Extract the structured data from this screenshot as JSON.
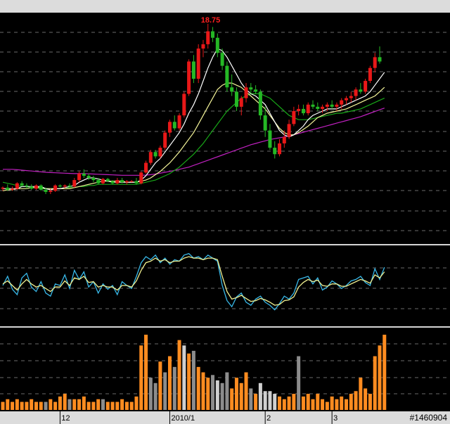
{
  "chart_data": {
    "type": "candlestick",
    "high_label": "18.75",
    "x_labels": [
      {
        "index": 12,
        "text": "12"
      },
      {
        "index": 35,
        "text": "2010/1"
      },
      {
        "index": 55,
        "text": "2"
      },
      {
        "index": 69,
        "text": "3"
      }
    ],
    "watermark": "#1460904",
    "candles": [
      [
        11.1,
        11.2,
        11.0,
        11.15
      ],
      [
        11.15,
        11.3,
        11.0,
        11.05
      ],
      [
        11.05,
        11.2,
        11.0,
        11.1
      ],
      [
        11.1,
        11.4,
        11.05,
        11.35
      ],
      [
        11.35,
        11.45,
        11.2,
        11.25
      ],
      [
        11.25,
        11.35,
        11.1,
        11.2
      ],
      [
        11.2,
        11.3,
        11.05,
        11.1
      ],
      [
        11.1,
        11.3,
        11.05,
        11.25
      ],
      [
        11.25,
        11.3,
        11.0,
        11.05
      ],
      [
        11.05,
        11.15,
        10.85,
        10.95
      ],
      [
        10.95,
        11.1,
        10.85,
        11.0
      ],
      [
        11.0,
        11.3,
        10.95,
        11.25
      ],
      [
        11.25,
        11.3,
        11.15,
        11.2
      ],
      [
        11.2,
        11.3,
        11.1,
        11.25
      ],
      [
        11.25,
        11.35,
        11.15,
        11.2
      ],
      [
        11.2,
        11.6,
        11.15,
        11.5
      ],
      [
        11.5,
        11.9,
        11.4,
        11.8
      ],
      [
        11.8,
        12.0,
        11.6,
        11.7
      ],
      [
        11.7,
        11.8,
        11.5,
        11.6
      ],
      [
        11.6,
        11.7,
        11.4,
        11.5
      ],
      [
        11.5,
        11.6,
        11.3,
        11.35
      ],
      [
        11.35,
        11.6,
        11.3,
        11.55
      ],
      [
        11.55,
        11.6,
        11.4,
        11.45
      ],
      [
        11.45,
        11.5,
        11.3,
        11.35
      ],
      [
        11.35,
        11.6,
        11.3,
        11.5
      ],
      [
        11.5,
        11.6,
        11.35,
        11.4
      ],
      [
        11.4,
        11.5,
        11.3,
        11.45
      ],
      [
        11.45,
        11.5,
        11.4,
        11.45
      ],
      [
        11.45,
        11.6,
        11.3,
        11.35
      ],
      [
        11.35,
        11.9,
        11.3,
        11.85
      ],
      [
        11.85,
        12.4,
        11.8,
        12.3
      ],
      [
        12.3,
        12.9,
        12.2,
        12.8
      ],
      [
        12.8,
        12.9,
        12.5,
        12.6
      ],
      [
        12.6,
        13.1,
        12.5,
        13.0
      ],
      [
        13.0,
        13.8,
        12.9,
        13.7
      ],
      [
        13.7,
        14.3,
        13.5,
        14.2
      ],
      [
        14.2,
        14.5,
        13.8,
        13.9
      ],
      [
        13.9,
        14.6,
        13.8,
        14.5
      ],
      [
        14.5,
        15.6,
        14.4,
        15.5
      ],
      [
        15.5,
        17.1,
        15.4,
        17.0
      ],
      [
        17.0,
        17.3,
        16.0,
        16.2
      ],
      [
        16.2,
        17.8,
        16.0,
        17.6
      ],
      [
        17.6,
        18.0,
        17.2,
        17.8
      ],
      [
        17.8,
        18.75,
        17.6,
        18.4
      ],
      [
        18.4,
        18.6,
        17.9,
        18.1
      ],
      [
        18.1,
        18.3,
        17.2,
        17.4
      ],
      [
        17.4,
        17.6,
        16.6,
        16.8
      ],
      [
        16.8,
        17.0,
        15.6,
        15.8
      ],
      [
        15.8,
        16.4,
        15.4,
        15.6
      ],
      [
        15.6,
        15.8,
        14.7,
        14.9
      ],
      [
        14.9,
        15.4,
        14.5,
        15.3
      ],
      [
        15.3,
        16.0,
        15.1,
        15.8
      ],
      [
        15.8,
        16.0,
        15.5,
        15.7
      ],
      [
        15.7,
        15.9,
        15.5,
        15.6
      ],
      [
        15.6,
        15.7,
        14.3,
        14.5
      ],
      [
        14.5,
        14.9,
        13.5,
        13.8
      ],
      [
        13.8,
        14.1,
        12.9,
        13.0
      ],
      [
        13.0,
        13.3,
        12.5,
        12.7
      ],
      [
        12.7,
        13.4,
        12.6,
        13.2
      ],
      [
        13.2,
        13.8,
        13.0,
        13.5
      ],
      [
        13.5,
        14.3,
        13.4,
        14.1
      ],
      [
        14.1,
        14.9,
        14.0,
        14.7
      ],
      [
        14.7,
        15.0,
        14.5,
        14.8
      ],
      [
        14.8,
        15.0,
        14.5,
        14.6
      ],
      [
        14.6,
        15.1,
        14.5,
        15.0
      ],
      [
        15.0,
        15.2,
        14.8,
        14.9
      ],
      [
        14.9,
        15.1,
        14.7,
        14.8
      ],
      [
        14.8,
        15.0,
        14.6,
        14.9
      ],
      [
        14.9,
        15.1,
        14.7,
        15.0
      ],
      [
        15.0,
        15.2,
        14.8,
        14.9
      ],
      [
        14.9,
        15.1,
        14.7,
        15.0
      ],
      [
        15.0,
        15.3,
        14.8,
        15.2
      ],
      [
        15.2,
        15.4,
        15.0,
        15.3
      ],
      [
        15.3,
        15.6,
        15.1,
        15.4
      ],
      [
        15.4,
        15.8,
        15.2,
        15.7
      ],
      [
        15.7,
        16.0,
        15.5,
        15.6
      ],
      [
        15.6,
        16.2,
        15.5,
        16.1
      ],
      [
        16.1,
        16.8,
        16.0,
        16.7
      ],
      [
        16.7,
        17.4,
        16.5,
        17.2
      ],
      [
        17.2,
        17.7,
        16.9,
        17.0
      ]
    ],
    "ma_fast": [
      11.1,
      11.1,
      11.1,
      11.1,
      11.2,
      11.2,
      11.2,
      11.2,
      11.2,
      11.1,
      11.05,
      11.1,
      11.1,
      11.15,
      11.2,
      11.25,
      11.4,
      11.5,
      11.6,
      11.6,
      11.55,
      11.5,
      11.45,
      11.4,
      11.4,
      11.4,
      11.4,
      11.4,
      11.4,
      11.5,
      11.7,
      12.0,
      12.3,
      12.5,
      12.8,
      13.1,
      13.4,
      13.7,
      14.1,
      14.6,
      15.0,
      15.5,
      16.1,
      16.7,
      17.2,
      17.6,
      17.5,
      17.2,
      16.8,
      16.4,
      16.0,
      15.7,
      15.5,
      15.4,
      15.2,
      15.0,
      14.6,
      14.2,
      13.8,
      13.6,
      13.5,
      13.6,
      13.8,
      14.0,
      14.3,
      14.5,
      14.6,
      14.7,
      14.8,
      14.8,
      14.8,
      14.9,
      15.0,
      15.1,
      15.2,
      15.3,
      15.4,
      15.6,
      15.9,
      16.2,
      16.5
    ],
    "ma_mid": [
      11.0,
      11.05,
      11.05,
      11.1,
      11.1,
      11.1,
      11.15,
      11.15,
      11.15,
      11.1,
      11.1,
      11.1,
      11.1,
      11.1,
      11.1,
      11.15,
      11.2,
      11.25,
      11.3,
      11.35,
      11.4,
      11.45,
      11.45,
      11.45,
      11.45,
      11.45,
      11.4,
      11.4,
      11.4,
      11.45,
      11.5,
      11.6,
      11.75,
      11.9,
      12.1,
      12.3,
      12.55,
      12.8,
      13.1,
      13.4,
      13.7,
      14.1,
      14.5,
      14.9,
      15.3,
      15.7,
      15.9,
      16.0,
      16.0,
      15.9,
      15.8,
      15.6,
      15.4,
      15.2,
      15.0,
      14.8,
      14.5,
      14.2,
      13.9,
      13.7,
      13.6,
      13.6,
      13.7,
      13.85,
      14.0,
      14.2,
      14.4,
      14.5,
      14.6,
      14.65,
      14.7,
      14.75,
      14.8,
      14.9,
      15.0,
      15.1,
      15.2,
      15.3,
      15.4,
      15.6,
      15.8
    ],
    "ma_slow": [
      11.4,
      11.35,
      11.3,
      11.25,
      11.2,
      11.2,
      11.15,
      11.15,
      11.1,
      11.1,
      11.1,
      11.1,
      11.1,
      11.1,
      11.15,
      11.15,
      11.2,
      11.2,
      11.25,
      11.25,
      11.3,
      11.3,
      11.3,
      11.3,
      11.3,
      11.3,
      11.3,
      11.3,
      11.3,
      11.35,
      11.4,
      11.45,
      11.5,
      11.6,
      11.7,
      11.8,
      11.95,
      12.1,
      12.3,
      12.5,
      12.7,
      12.95,
      13.2,
      13.5,
      13.8,
      14.1,
      14.4,
      14.7,
      14.9,
      15.1,
      15.3,
      15.4,
      15.5,
      15.5,
      15.5,
      15.4,
      15.3,
      15.1,
      14.9,
      14.7,
      14.5,
      14.4,
      14.3,
      14.3,
      14.3,
      14.35,
      14.4,
      14.45,
      14.5,
      14.55,
      14.6,
      14.6,
      14.65,
      14.7,
      14.75,
      14.8,
      14.9,
      15.0,
      15.1,
      15.2,
      15.3
    ],
    "ma_long": [
      12.0,
      12.0,
      12.0,
      11.98,
      11.96,
      11.94,
      11.92,
      11.9,
      11.88,
      11.86,
      11.85,
      11.84,
      11.83,
      11.82,
      11.81,
      11.8,
      11.8,
      11.8,
      11.79,
      11.78,
      11.77,
      11.76,
      11.75,
      11.74,
      11.73,
      11.72,
      11.72,
      11.72,
      11.72,
      11.72,
      11.73,
      11.75,
      11.78,
      11.82,
      11.86,
      11.9,
      11.95,
      12.0,
      12.05,
      12.1,
      12.18,
      12.26,
      12.34,
      12.42,
      12.5,
      12.58,
      12.66,
      12.74,
      12.82,
      12.9,
      12.98,
      13.06,
      13.14,
      13.2,
      13.26,
      13.32,
      13.38,
      13.42,
      13.46,
      13.5,
      13.55,
      13.6,
      13.66,
      13.72,
      13.78,
      13.84,
      13.9,
      13.96,
      14.02,
      14.08,
      14.14,
      14.2,
      14.26,
      14.32,
      14.38,
      14.44,
      14.52,
      14.6,
      14.68,
      14.76,
      14.84
    ],
    "osc_k": [
      50,
      62,
      45,
      38,
      60,
      66,
      48,
      42,
      55,
      40,
      36,
      52,
      50,
      64,
      46,
      70,
      58,
      68,
      48,
      55,
      40,
      52,
      45,
      50,
      38,
      55,
      50,
      46,
      62,
      80,
      88,
      84,
      90,
      80,
      86,
      78,
      84,
      82,
      90,
      92,
      86,
      88,
      84,
      90,
      86,
      82,
      50,
      30,
      22,
      35,
      40,
      28,
      24,
      32,
      36,
      28,
      24,
      18,
      26,
      36,
      32,
      40,
      58,
      60,
      62,
      52,
      60,
      44,
      48,
      56,
      52,
      46,
      50,
      56,
      58,
      62,
      54,
      50,
      72,
      58,
      74
    ],
    "osc_d": [
      52,
      56,
      50,
      44,
      52,
      58,
      52,
      48,
      50,
      46,
      42,
      48,
      48,
      56,
      50,
      60,
      58,
      62,
      54,
      55,
      48,
      50,
      48,
      48,
      44,
      50,
      50,
      48,
      56,
      70,
      80,
      82,
      86,
      82,
      84,
      80,
      82,
      82,
      86,
      88,
      86,
      86,
      84,
      86,
      86,
      84,
      62,
      42,
      32,
      34,
      37,
      33,
      29,
      30,
      33,
      31,
      28,
      24,
      25,
      30,
      31,
      35,
      48,
      54,
      58,
      55,
      57,
      50,
      49,
      52,
      52,
      49,
      49,
      52,
      55,
      58,
      56,
      53,
      64,
      60,
      68
    ],
    "osc_ylim": [
      0,
      100
    ],
    "volume": [
      3,
      4,
      3,
      4,
      3,
      3,
      4,
      3,
      3,
      3,
      4,
      3,
      5,
      6,
      4,
      4,
      4,
      5,
      3,
      3,
      4,
      4,
      3,
      3,
      3,
      4,
      3,
      3,
      5,
      24,
      28,
      12,
      10,
      18,
      14,
      20,
      16,
      26,
      24,
      21,
      22,
      16,
      14,
      12,
      13,
      11,
      10,
      14,
      8,
      12,
      10,
      14,
      8,
      6,
      10,
      7,
      7,
      6,
      5,
      4,
      5,
      6,
      20,
      5,
      6,
      4,
      6,
      4,
      3,
      5,
      4,
      5,
      4,
      6,
      7,
      12,
      8,
      6,
      20,
      24,
      28
    ],
    "volume_colors": [
      "o",
      "o",
      "o",
      "o",
      "o",
      "o",
      "o",
      "o",
      "o",
      "g",
      "o",
      "o",
      "o",
      "o",
      "g",
      "o",
      "o",
      "o",
      "o",
      "o",
      "o",
      "g",
      "o",
      "o",
      "o",
      "o",
      "o",
      "o",
      "o",
      "o",
      "o",
      "g",
      "g",
      "o",
      "g",
      "o",
      "g",
      "o",
      "w",
      "o",
      "g",
      "o",
      "o",
      "o",
      "g",
      "w",
      "g",
      "g",
      "o",
      "o",
      "o",
      "o",
      "g",
      "o",
      "w",
      "w",
      "w",
      "w",
      "o",
      "o",
      "o",
      "o",
      "g",
      "o",
      "o",
      "o",
      "o",
      "o",
      "o",
      "o",
      "o",
      "o",
      "o",
      "o",
      "o",
      "o",
      "o",
      "o",
      "o",
      "o",
      "o"
    ],
    "price_ylim": [
      8.6,
      19.2
    ],
    "colors": {
      "up": "#e81818",
      "down": "#25b825",
      "ma_fast": "#ffffff",
      "ma_mid": "#f5f59a",
      "ma_slow": "#18a818",
      "ma_long": "#c020c0",
      "osc_k": "#38b8e8",
      "osc_d": "#f0f090",
      "vol_up": "#ff8c20",
      "vol_gray": "#8c8c8c",
      "vol_light": "#d0d0d0",
      "axis_bar": "#dcdcdc"
    }
  }
}
